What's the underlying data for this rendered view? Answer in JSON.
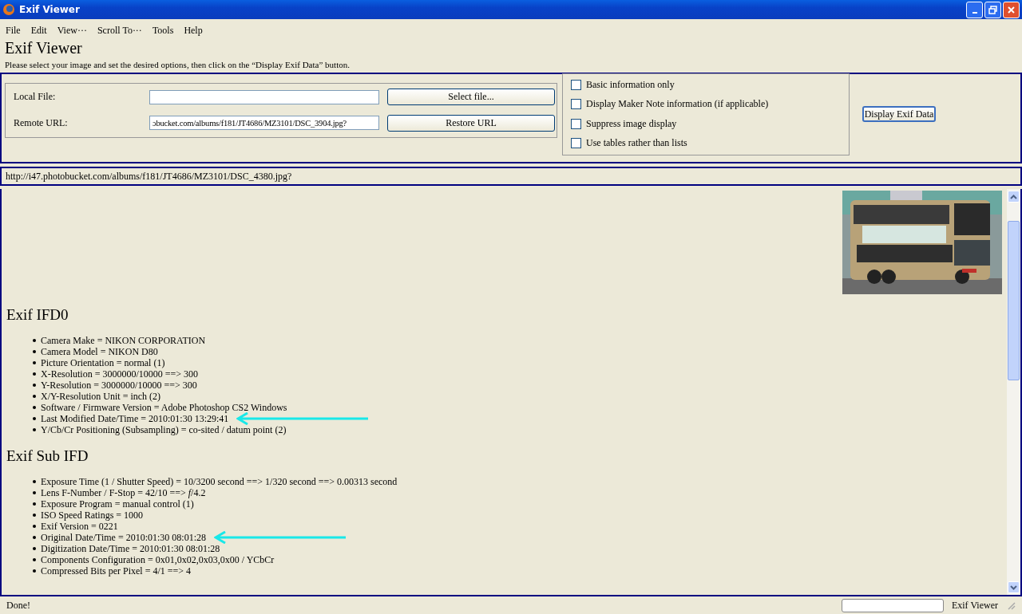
{
  "window": {
    "title": "Exif Viewer"
  },
  "menu": [
    "File",
    "Edit",
    "View···",
    "Scroll To···",
    "Tools",
    "Help"
  ],
  "heading": "Exif Viewer",
  "instructions": "Please select your image and set the desired options, then click on the “Display Exif Data” button.",
  "source": {
    "local_file": {
      "label": "Local File:",
      "button": "Select file..."
    },
    "remote_url": {
      "label": "Remote URL:",
      "value": "ɔbucket.com/albums/f181/JT4686/MZ3101/DSC_3904.jpg?",
      "button": "Restore URL"
    }
  },
  "options": [
    {
      "label": "Basic information only",
      "checked": false
    },
    {
      "label": "Display Maker Note information (if applicable)",
      "checked": false
    },
    {
      "label": "Suppress image display",
      "checked": false
    },
    {
      "label": "Use tables rather than lists",
      "checked": false
    }
  ],
  "submit": "Display Exif Data",
  "current_url": "http://i47.photobucket.com/albums/f181/JT4686/MZ3101/DSC_4380.jpg?",
  "sections": [
    {
      "title": "Exif IFD0",
      "items": [
        {
          "text": "Camera Make = NIKON CORPORATION",
          "arrow": false
        },
        {
          "text": "Camera Model = NIKON D80",
          "arrow": false
        },
        {
          "text": "Picture Orientation = normal (1)",
          "arrow": false
        },
        {
          "text": "X-Resolution = 3000000/10000 ==> 300",
          "arrow": false
        },
        {
          "text": "Y-Resolution = 3000000/10000 ==> 300",
          "arrow": false
        },
        {
          "text": "X/Y-Resolution Unit = inch (2)",
          "arrow": false
        },
        {
          "text": "Software / Firmware Version = Adobe Photoshop CS2 Windows",
          "arrow": false
        },
        {
          "text": "Last Modified Date/Time = 2010:01:30 13:29:41",
          "arrow": true
        },
        {
          "text": "Y/Cb/Cr Positioning (Subsampling) = co-sited / datum point (2)",
          "arrow": false
        }
      ]
    },
    {
      "title": "Exif Sub IFD",
      "items": [
        {
          "text": "Exposure Time (1 / Shutter Speed) = 10/3200 second ==> 1/320 second ==> 0.00313 second",
          "arrow": false
        },
        {
          "text": "Lens F-Number / F-Stop = 42/10 ==> *f*/4.2",
          "arrow": false
        },
        {
          "text": "Exposure Program = manual control (1)",
          "arrow": false
        },
        {
          "text": "ISO Speed Ratings = 1000",
          "arrow": false
        },
        {
          "text": "Exif Version = 0221",
          "arrow": false
        },
        {
          "text": "Original Date/Time = 2010:01:30 08:01:28",
          "arrow": true
        },
        {
          "text": "Digitization Date/Time = 2010:01:30 08:01:28",
          "arrow": false
        },
        {
          "text": "Components Configuration = 0x01,0x02,0x03,0x00 / YCbCr",
          "arrow": false
        },
        {
          "text": "Compressed Bits per Pixel = 4/1 ==> 4",
          "arrow": false
        }
      ]
    }
  ],
  "status_bar": {
    "message": "Done!",
    "app": "Exif Viewer"
  }
}
